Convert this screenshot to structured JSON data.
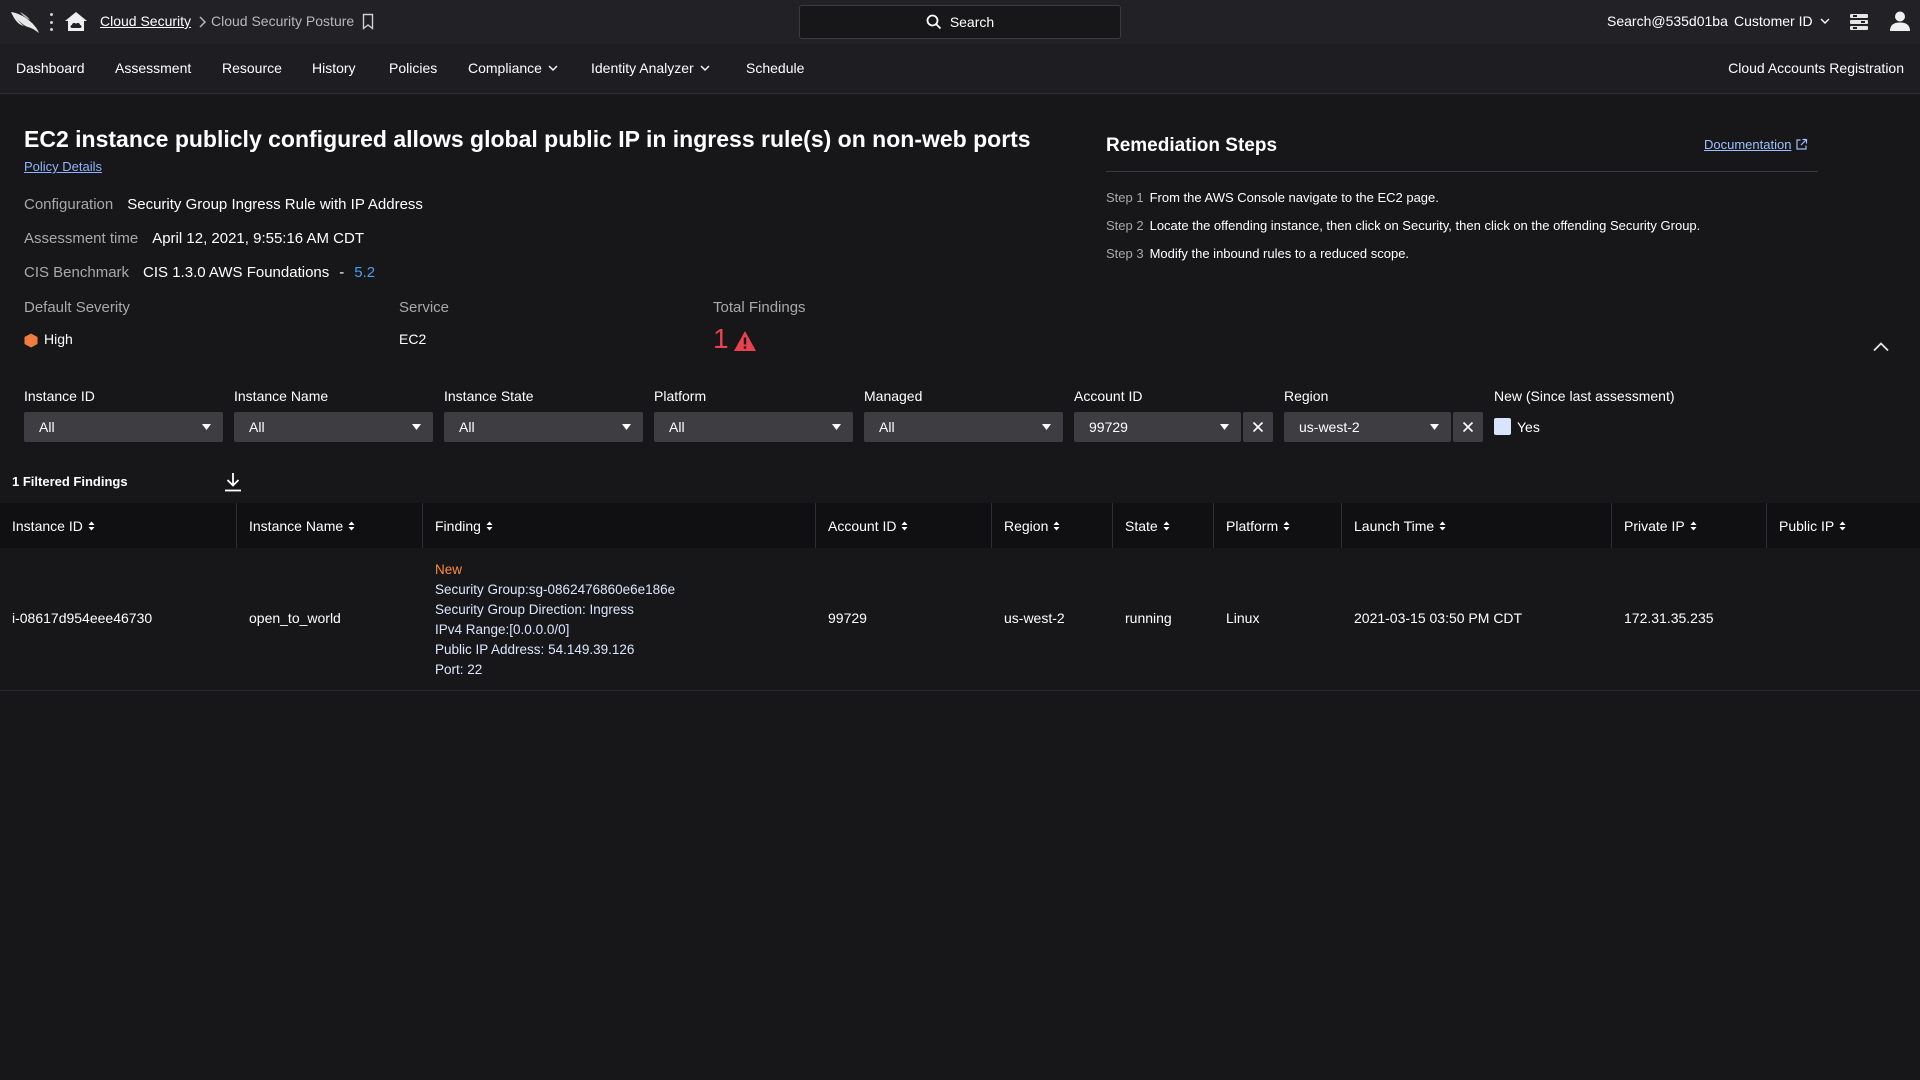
{
  "topbar": {
    "breadcrumb_link": "Cloud Security",
    "breadcrumb_current": "Cloud Security Posture",
    "search_label": "Search",
    "user": "Search@535d01ba",
    "customer_id": "Customer ID"
  },
  "nav": {
    "items": [
      {
        "label": "Dashboard"
      },
      {
        "label": "Assessment"
      },
      {
        "label": "Resource"
      },
      {
        "label": "History"
      },
      {
        "label": "Policies"
      },
      {
        "label": "Compliance"
      },
      {
        "label": "Identity Analyzer"
      },
      {
        "label": "Schedule"
      }
    ],
    "right": "Cloud Accounts Registration"
  },
  "policy": {
    "title": "EC2 instance publicly configured allows global public IP in ingress rule(s) on non-web ports",
    "details_link": "Policy Details",
    "configuration_label": "Configuration",
    "configuration_value": "Security Group Ingress Rule with IP Address",
    "assessment_label": "Assessment time",
    "assessment_value": "April 12, 2021, 9:55:16 AM CDT",
    "cis_label": "CIS Benchmark",
    "cis_value": "CIS 1.3.0 AWS Foundations",
    "cis_dash": "-",
    "cis_section": "5.2",
    "severity_label": "Default Severity",
    "severity_value": "High",
    "service_label": "Service",
    "service_value": "EC2",
    "findings_label": "Total Findings",
    "findings_value": "1"
  },
  "remediation": {
    "title": "Remediation Steps",
    "doc_link": "Documentation",
    "steps": [
      {
        "num": "Step 1",
        "text": "From the AWS Console navigate to the EC2 page."
      },
      {
        "num": "Step 2",
        "text": "Locate the offending instance, then click on Security, then click on the offending Security Group."
      },
      {
        "num": "Step 3",
        "text": "Modify the inbound rules to a reduced scope."
      }
    ]
  },
  "filters": {
    "instance_id": {
      "label": "Instance ID",
      "value": "All"
    },
    "instance_name": {
      "label": "Instance Name",
      "value": "All"
    },
    "instance_state": {
      "label": "Instance State",
      "value": "All"
    },
    "platform": {
      "label": "Platform",
      "value": "All"
    },
    "managed": {
      "label": "Managed",
      "value": "All"
    },
    "account_id": {
      "label": "Account ID",
      "value": "99729"
    },
    "region": {
      "label": "Region",
      "value": "us-west-2"
    },
    "new_since": {
      "label": "New (Since last assessment)",
      "checkbox_label": "Yes"
    }
  },
  "results": {
    "count_label": "1 Filtered Findings",
    "columns": [
      "Instance ID",
      "Instance Name",
      "Finding",
      "Account ID",
      "Region",
      "State",
      "Platform",
      "Launch Time",
      "Private IP",
      "Public IP"
    ],
    "row": {
      "instance_id": "i-08617d954eee46730",
      "instance_name": "open_to_world",
      "finding_status": "New",
      "finding_lines": [
        "Security Group:sg-0862476860e6e186e",
        "Security Group Direction: Ingress",
        "IPv4 Range:[0.0.0.0/0]",
        "Public IP Address: 54.149.39.126",
        "Port: 22"
      ],
      "account_id": "99729",
      "region": "us-west-2",
      "state": "running",
      "platform": "Linux",
      "launch_time": "2021-03-15 03:50 PM CDT",
      "private_ip": "172.31.35.235",
      "public_ip": ""
    }
  },
  "colors": {
    "background": "#17171a",
    "accent_link": "#4a9df0",
    "severity_high": "#f07b3f",
    "alert_red": "#e8414f",
    "new_badge": "#ff8a3d"
  }
}
